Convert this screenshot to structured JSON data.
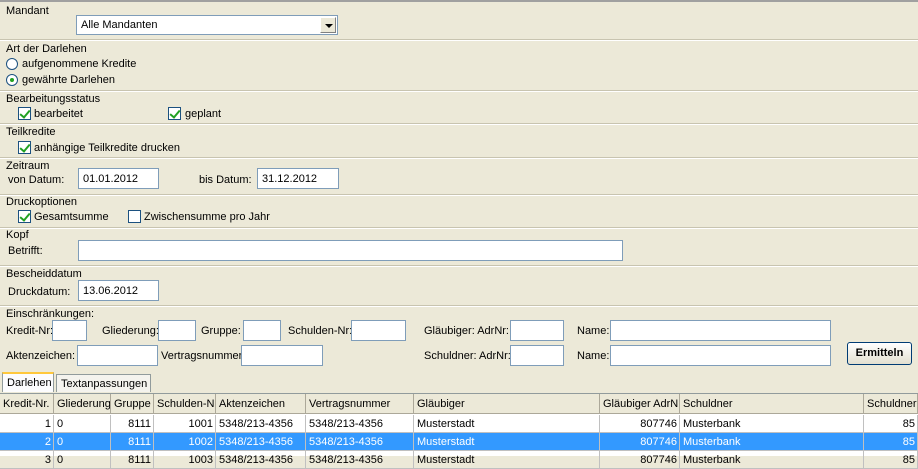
{
  "mandant": {
    "label": "Mandant",
    "value": "Alle Mandanten"
  },
  "art": {
    "label": "Art der Darlehen",
    "opt1": "aufgenommene Kredite",
    "opt2": "gewährte Darlehen"
  },
  "bearbeitung": {
    "label": "Bearbeitungsstatus",
    "cb1": "bearbeitet",
    "cb2": "geplant"
  },
  "teilkredite": {
    "label": "Teilkredite",
    "cb1": "anhängige Teilkredite drucken"
  },
  "zeitraum": {
    "label": "Zeitraum",
    "von_label": "von Datum:",
    "von_value": "01.01.2012",
    "bis_label": "bis Datum:",
    "bis_value": "31.12.2012"
  },
  "druckoptionen": {
    "label": "Druckoptionen",
    "cb1": "Gesamtsumme",
    "cb2": "Zwischensumme pro Jahr"
  },
  "kopf": {
    "label": "Kopf",
    "betrifft_label": "Betrifft:",
    "betrifft_value": ""
  },
  "bescheid": {
    "label": "Bescheiddatum",
    "druck_label": "Druckdatum:",
    "druck_value": "13.06.2012"
  },
  "einschr": {
    "label": "Einschränkungen:",
    "kredit_nr": "Kredit-Nr:",
    "gliederung": "Gliederung:",
    "gruppe": "Gruppe:",
    "schulden_nr": "Schulden-Nr:",
    "glaeubiger_adrnr": "Gläubiger: AdrNr:",
    "name1": "Name:",
    "aktenzeichen": "Aktenzeichen:",
    "vertragsnummer": "Vertragsnummer:",
    "schuldner_adrnr": "Schuldner: AdrNr:",
    "name2": "Name:",
    "ermitteln": "Ermitteln"
  },
  "tabs": [
    "Darlehen",
    "Textanpassungen"
  ],
  "grid": {
    "headers": [
      "Kredit-Nr.",
      "Gliederung",
      "Gruppe",
      "Schulden-Nr",
      "Aktenzeichen",
      "Vertragsnummer",
      "Gläubiger",
      "Gläubiger AdrNr",
      "Schuldner",
      "Schuldner"
    ],
    "rows": [
      [
        "1",
        "0",
        "8111",
        "1001",
        "5348/213-4356",
        "5348/213-4356",
        "Musterstadt",
        "807746",
        "Musterbank",
        "85"
      ],
      [
        "2",
        "0",
        "8111",
        "1002",
        "5348/213-4356",
        "5348/213-4356",
        "Musterstadt",
        "807746",
        "Musterbank",
        "85"
      ],
      [
        "3",
        "0",
        "8111",
        "1003",
        "5348/213-4356",
        "5348/213-4356",
        "Musterstadt",
        "807746",
        "Musterbank",
        "85"
      ]
    ]
  },
  "colors": {
    "selection": "#3399ff",
    "window_bg": "#ece9d8",
    "input_border": "#7f9db9"
  }
}
